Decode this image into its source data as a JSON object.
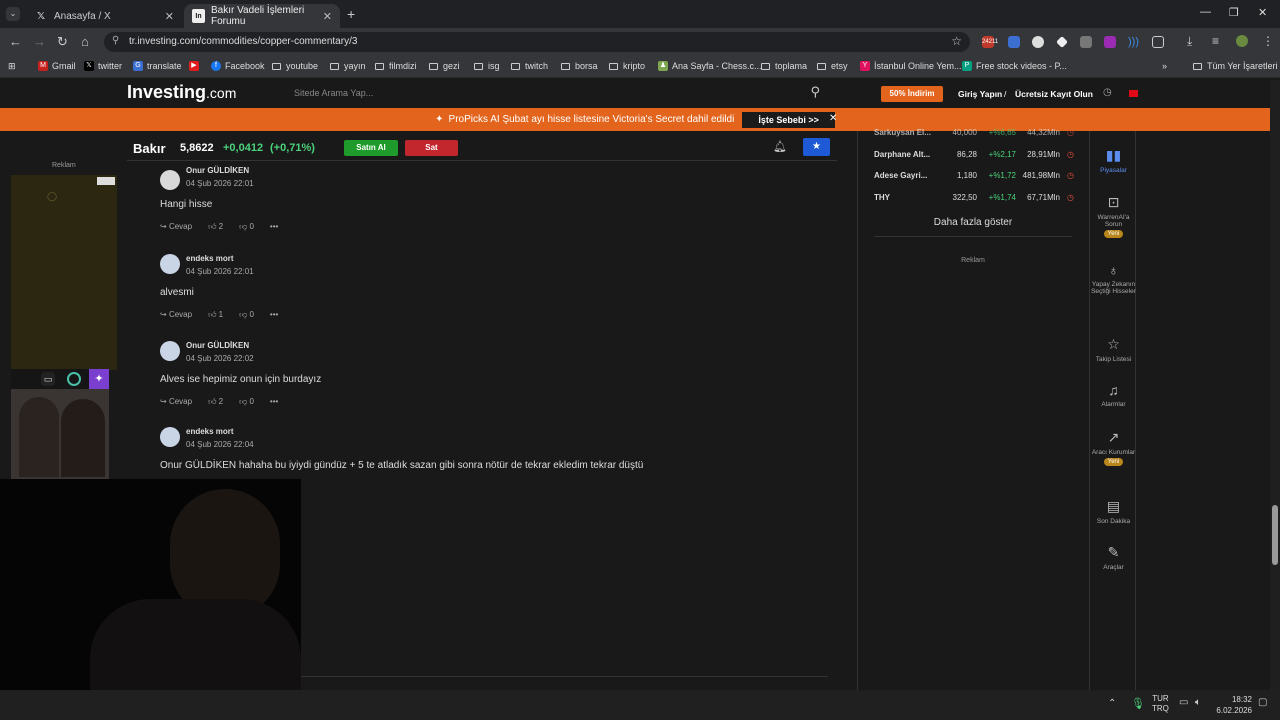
{
  "browser": {
    "tabs": [
      {
        "title": "Anasayfa / X",
        "icon": "x-logo-icon"
      },
      {
        "title": "Bakır Vadeli İşlemleri Forumu",
        "icon": "investing-favicon"
      }
    ],
    "url": "tr.investing.com/commodities/copper-commentary/3",
    "bookmarks": [
      "Gmail",
      "twitter",
      "translate",
      "Facebook",
      "youtube",
      "yayın",
      "filmdizi",
      "gezi",
      "isg",
      "twitch",
      "borsa",
      "kripto",
      "Ana Sayfa - Chess.c...",
      "toplama",
      "etsy",
      "İstanbul Online Yem...",
      "Free stock videos - P...",
      "Tüm Yer İşaretleri"
    ],
    "ext_badge": "24211"
  },
  "header": {
    "logo": "Investing",
    "logo_suffix": ".com",
    "search_placeholder": "Sitede Arama Yap...",
    "discount": "50% İndirim",
    "login": "Giriş Yapın",
    "sep": "/",
    "signup": "Ücretsiz Kayıt Olun"
  },
  "promo": {
    "text": "ProPicks AI Şubat ayı hisse listesine Victoria's Secret dahil edildi",
    "button": "İşte Sebebi >>"
  },
  "instrument": {
    "name": "Bakır",
    "price": "5,8622",
    "change": "+0,0412",
    "change_pct": "(+0,71%)",
    "buy": "Satın Al",
    "sell": "Sat"
  },
  "ad_label": "Reklam",
  "comments": [
    {
      "author": "Onur GÜLDİKEN",
      "date": "04 Şub 2026 22:01",
      "text": "Hangi hisse",
      "reply": "Cevap",
      "likes": "2",
      "dislikes": "0"
    },
    {
      "author": "endeks mort",
      "date": "04 Şub 2026 22:01",
      "text": "alvesmi",
      "reply": "Cevap",
      "likes": "1",
      "dislikes": "0"
    },
    {
      "author": "Onur GÜLDİKEN",
      "date": "04 Şub 2026 22:02",
      "text": "Alves ise hepimiz onun için burdayız",
      "reply": "Cevap",
      "likes": "2",
      "dislikes": "0"
    },
    {
      "author": "endeks mort",
      "date": "04 Şub 2026 22:04",
      "text": "Onur GÜLDİKEN hahaha bu iyiydi gündüz + 5 te atladık sazan gibi sonra nötür de tekrar ekledim tekrar düştü"
    }
  ],
  "market": {
    "rows": [
      {
        "name": "Sarkuysan El...",
        "price": "40,000",
        "change": "+%6,65",
        "volume": "44,32Mln"
      },
      {
        "name": "Darphane Alt...",
        "price": "86,28",
        "change": "+%2,17",
        "volume": "28,91Mln"
      },
      {
        "name": "Adese Gayri...",
        "price": "1,180",
        "change": "+%1,72",
        "volume": "481,98Mln"
      },
      {
        "name": "THY",
        "price": "322,50",
        "change": "+%1,74",
        "volume": "67,71Mln"
      }
    ],
    "show_more": "Daha fazla göster",
    "ad_label": "Reklam"
  },
  "sidebar": [
    {
      "icon": "bar-chart-icon",
      "label": "Piyasalar"
    },
    {
      "icon": "ai-icon",
      "label": "WarrenAI'a Sorun",
      "badge": "Yeni"
    },
    {
      "icon": "lightbulb-icon",
      "label": "Yapay Zekanın Seçtiği Hisseler"
    },
    {
      "icon": "star-icon",
      "label": "Takip Listesi"
    },
    {
      "icon": "bell-icon",
      "label": "Alarmlar"
    },
    {
      "icon": "trend-icon",
      "label": "Aracı Kurumlar",
      "badge": "Yeni"
    },
    {
      "icon": "news-icon",
      "label": "Son Dakika"
    },
    {
      "icon": "wrench-icon",
      "label": "Araçlar"
    }
  ],
  "taskbar": {
    "lang1": "TUR",
    "lang2": "TRQ",
    "time": "18:32",
    "date": "6.02.2026"
  }
}
